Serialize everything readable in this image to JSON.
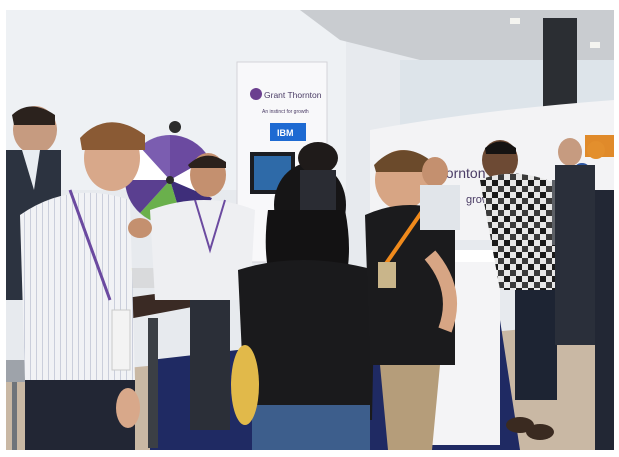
{
  "banner": {
    "brand_name": "Grant Thornton",
    "tagline": "An instinct for growth",
    "sponsor_logo_text": "IBM"
  },
  "back_wall": {
    "brand_fragment": "hornton",
    "tagline_fragment": "growth"
  }
}
